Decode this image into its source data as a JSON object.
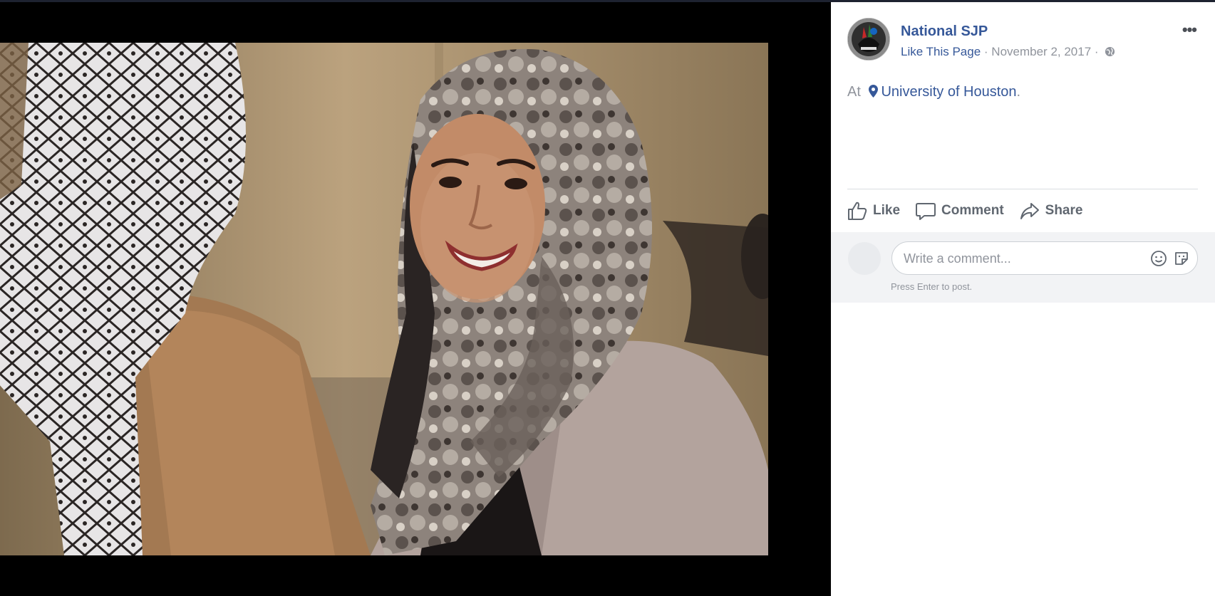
{
  "post": {
    "page_name": "National SJP",
    "like_page": "Like This Page",
    "separator": "·",
    "date": "November 2, 2017",
    "location_prefix": "At",
    "location_name": "University of Houston",
    "location_suffix": ".",
    "audience_icon": "globe-icon",
    "more_icon": "more-options-icon",
    "more_glyph": "•••"
  },
  "actions": {
    "like": "Like",
    "comment": "Comment",
    "share": "Share"
  },
  "composer": {
    "placeholder": "Write a comment...",
    "hint": "Press Enter to post."
  },
  "colors": {
    "link": "#365899",
    "meta": "#90949c",
    "viewer_background": "#000000"
  }
}
